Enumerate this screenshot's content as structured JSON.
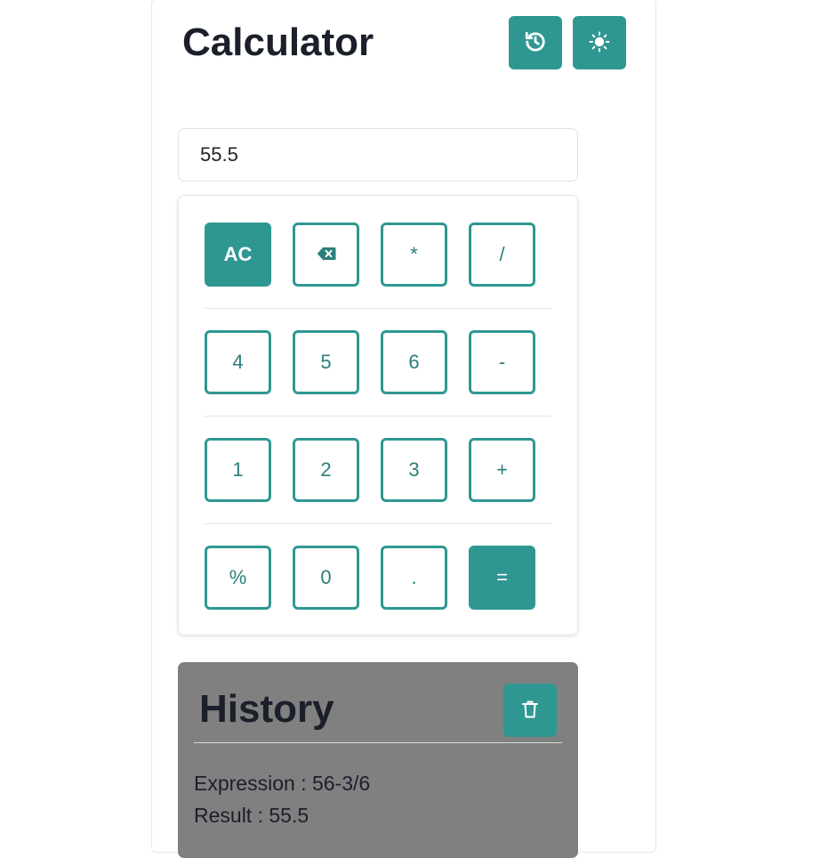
{
  "header": {
    "title": "Calculator",
    "history_icon": "history-icon",
    "theme_icon": "sun-icon"
  },
  "display": {
    "value": "55.5"
  },
  "keypad": {
    "rows": [
      [
        "AC",
        "backspace",
        "*",
        "/"
      ],
      [
        "4",
        "5",
        "6",
        "-"
      ],
      [
        "1",
        "2",
        "3",
        "+"
      ],
      [
        "%",
        "0",
        ".",
        "="
      ]
    ],
    "labels": {
      "ac": "AC",
      "backspace_icon": "backspace-icon",
      "multiply": "*",
      "divide": "/",
      "four": "4",
      "five": "5",
      "six": "6",
      "minus": "-",
      "one": "1",
      "two": "2",
      "three": "3",
      "plus": "+",
      "percent": "%",
      "zero": "0",
      "dot": ".",
      "equals": "="
    }
  },
  "history": {
    "title": "History",
    "clear_icon": "trash-icon",
    "entries": [
      {
        "expression": "Expression : 56-3/6",
        "result": "Result : 55.5"
      }
    ]
  },
  "colors": {
    "accent": "#2f9792",
    "accent_text": "#2a7f7b",
    "history_bg": "#808080",
    "title_text": "#1b1f2a"
  }
}
